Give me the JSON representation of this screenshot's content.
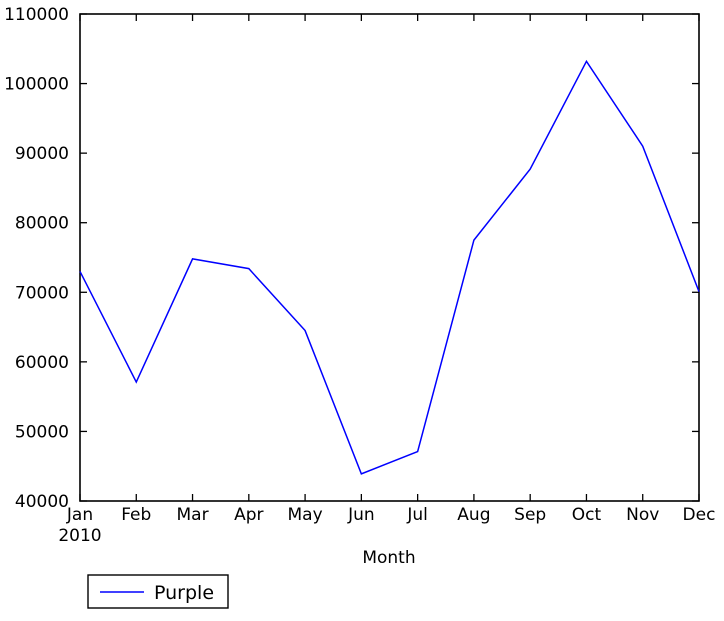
{
  "chart_data": {
    "type": "line",
    "title": "",
    "xlabel": "Month",
    "ylabel": "",
    "categories": [
      "Jan",
      "Feb",
      "Mar",
      "Apr",
      "May",
      "Jun",
      "Jul",
      "Aug",
      "Sep",
      "Oct",
      "Nov",
      "Dec"
    ],
    "x_sublabel": "2010",
    "xtick_labels": [
      "Jan",
      "Feb",
      "Mar",
      "Apr",
      "May",
      "Jun",
      "Jul",
      "Aug",
      "Sep",
      "Oct",
      "Nov",
      "Dec"
    ],
    "ytick_labels": [
      "40000",
      "50000",
      "60000",
      "70000",
      "80000",
      "90000",
      "100000",
      "110000"
    ],
    "ytick_values": [
      40000,
      50000,
      60000,
      70000,
      80000,
      90000,
      100000,
      110000
    ],
    "ylim": [
      40000,
      110000
    ],
    "xlim": [
      0,
      11
    ],
    "grid": false,
    "legend_position": "below-left",
    "series": [
      {
        "name": "Purple",
        "color": "#0000ff",
        "values": [
          73000,
          57100,
          74800,
          73400,
          64500,
          43900,
          47100,
          77500,
          87700,
          103200,
          91000,
          70100
        ]
      }
    ]
  },
  "legend": {
    "entries": [
      {
        "label": "Purple",
        "color": "#0000ff"
      }
    ]
  },
  "axes": {
    "x_label": "Month",
    "x_sublabel": "2010"
  }
}
